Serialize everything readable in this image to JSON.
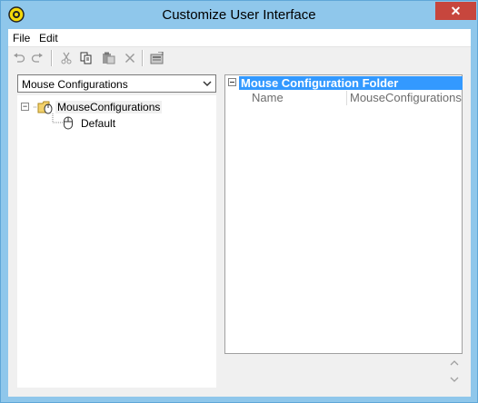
{
  "window": {
    "title": "Customize User Interface",
    "close_label": "✕"
  },
  "menu": {
    "items": [
      {
        "label": "File"
      },
      {
        "label": "Edit"
      }
    ]
  },
  "toolbar": {
    "buttons": [
      "undo-icon",
      "redo-icon",
      "cut-icon",
      "copy-icon",
      "paste-icon",
      "delete-icon",
      "properties-icon"
    ]
  },
  "combo": {
    "value": "Mouse Configurations"
  },
  "tree": {
    "root": {
      "label": "MouseConfigurations",
      "expander": "−"
    },
    "children": [
      {
        "label": "Default"
      }
    ]
  },
  "properties": {
    "category": "Mouse Configuration Folder",
    "collapse": "−",
    "rows": [
      {
        "name": "Name",
        "value": "MouseConfigurations"
      }
    ]
  },
  "colors": {
    "frame": "#8fc7eb",
    "selection": "#3399ff",
    "close": "#c7463d"
  }
}
